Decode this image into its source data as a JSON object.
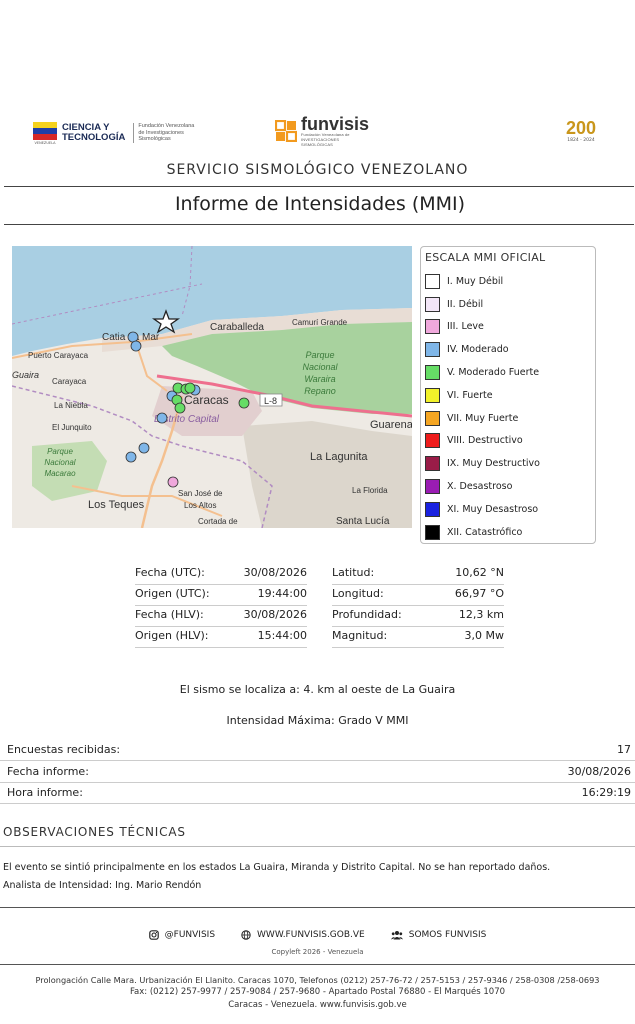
{
  "header": {
    "left_logo_title_line1": "CIENCIA Y",
    "left_logo_title_line2": "TECNOLOGÍA",
    "left_logo_flag_caption": "VENEZUELA",
    "left_logo_sub_line1": "Fundación Venezolana",
    "left_logo_sub_line2": "de Investigaciones",
    "left_logo_sub_line3": "Sismológicas",
    "center_logo_name": "funvisis",
    "center_logo_sub": "Fundación Venezolana de INVESTIGACIONES SISMOLÓGICAS",
    "right_logo_text": "200",
    "right_logo_years": "1824 - 2024"
  },
  "org_title": "SERVICIO SISMOLÓGICO VENEZOLANO",
  "report_title": "Informe de Intensidades (MMI)",
  "map": {
    "place_labels": [
      {
        "text": "Catia La Mar"
      },
      {
        "text": "Caraballeda"
      },
      {
        "text": "Camurí Grande"
      },
      {
        "text": "Puerto Carayaca"
      },
      {
        "text": "Carayaca"
      },
      {
        "text": "La Niebla"
      },
      {
        "text": "El Junquito"
      },
      {
        "text": "Caracas"
      },
      {
        "text": "Distrito Capital"
      },
      {
        "text": "Parque"
      },
      {
        "text": "Nacional"
      },
      {
        "text": "Waraira"
      },
      {
        "text": "Repano"
      },
      {
        "text": "L-8"
      },
      {
        "text": "Guarenas"
      },
      {
        "text": "La Lagunita"
      },
      {
        "text": "La Florida"
      },
      {
        "text": "Los Teques"
      },
      {
        "text": "San José de"
      },
      {
        "text": "Los Altos"
      },
      {
        "text": "Cortada de"
      },
      {
        "text": "Santa Lucía"
      },
      {
        "text": "Parque"
      },
      {
        "text": "Nacional"
      },
      {
        "text": "Macarao"
      },
      {
        "text": "Guaira"
      }
    ]
  },
  "legend": {
    "title": "ESCALA MMI OFICIAL",
    "items": [
      {
        "label": "I. Muy Débil",
        "color": "#ffffff"
      },
      {
        "label": "II. Débil",
        "color": "#f3e6f7"
      },
      {
        "label": "III. Leve",
        "color": "#f0a8dc"
      },
      {
        "label": "IV. Moderado",
        "color": "#7fb6e8"
      },
      {
        "label": "V. Moderado Fuerte",
        "color": "#66dd66"
      },
      {
        "label": "VI. Fuerte",
        "color": "#f2f22a"
      },
      {
        "label": "VII. Muy Fuerte",
        "color": "#f5a623"
      },
      {
        "label": "VIII. Destructivo",
        "color": "#ee1c1c"
      },
      {
        "label": "IX. Muy Destructivo",
        "color": "#9a1c48"
      },
      {
        "label": "X. Desastroso",
        "color": "#9a1cb3"
      },
      {
        "label": "XI. Muy Desastroso",
        "color": "#1a22e0"
      },
      {
        "label": "XII. Catastrófico",
        "color": "#000000"
      }
    ]
  },
  "event": {
    "fecha_utc_label": "Fecha (UTC):",
    "fecha_utc": "30/08/2026",
    "origen_utc_label": "Origen (UTC):",
    "origen_utc": "19:44:00",
    "fecha_hlv_label": "Fecha (HLV):",
    "fecha_hlv": "30/08/2026",
    "origen_hlv_label": "Origen (HLV):",
    "origen_hlv": "15:44:00",
    "latitud_label": "Latitud:",
    "latitud": "10,62 °N",
    "longitud_label": "Longitud:",
    "longitud": "66,97 °O",
    "profundidad_label": "Profundidad:",
    "profundidad": "12,3 km",
    "magnitud_label": "Magnitud:",
    "magnitud": "3,0 Mw"
  },
  "location_text": "El sismo se localiza a: 4. km al oeste de La Guaira",
  "max_intensity": "Intensidad Máxima: Grado V MMI",
  "info": {
    "encuestas_label": "Encuestas recibidas:",
    "encuestas": "17",
    "fecha_informe_label": "Fecha informe:",
    "fecha_informe": "30/08/2026",
    "hora_informe_label": "Hora informe:",
    "hora_informe": "16:29:19"
  },
  "observations": {
    "title": "OBSERVACIONES TÉCNICAS",
    "text": "El evento se sintió principalmente en los estados La Guaira, Miranda y Distrito Capital. No se han reportado daños.",
    "analyst": "Analista de Intensidad: Ing. Mario Rendón"
  },
  "footer": {
    "social_instagram": "@FUNVISIS",
    "social_web": "WWW.FUNVISIS.GOB.VE",
    "social_group": "SOMOS FUNVISIS",
    "copyleft": "Copyleft 2026 - Venezuela",
    "address_line1": "Prolongación Calle Mara. Urbanización El Llanito. Caracas 1070, Telefonos (0212) 257-76-72 / 257-5153 / 257-9346 / 258-0308 /258-0693",
    "address_line2": "Fax: (0212) 257-9977 / 257-9084 / 257-9680 - Apartado Postal 76880 - El Marqués 1070",
    "address_line3": "Caracas - Venezuela. www.funvisis.gob.ve"
  }
}
